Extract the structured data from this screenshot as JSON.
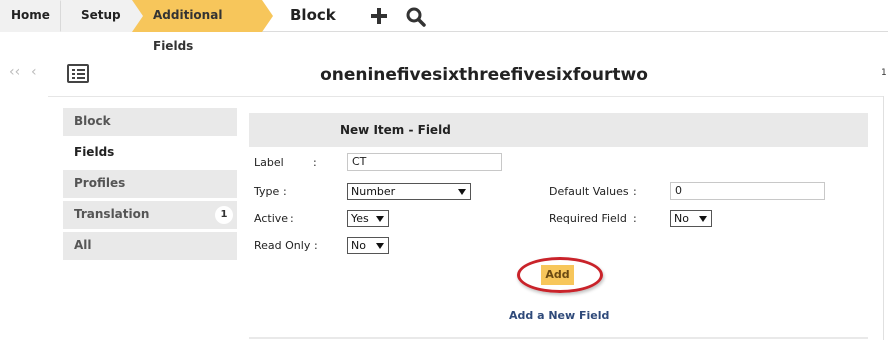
{
  "breadcrumb": {
    "items": [
      "Home",
      "Setup",
      "Additional Fields"
    ],
    "current": "Block"
  },
  "icons": {
    "add": "plus-icon",
    "search": "search-icon",
    "list": "list-icon"
  },
  "record": {
    "title": "oneninefivesixthreefivesixfourtwo",
    "right_indicator": "1"
  },
  "menu": {
    "items": [
      {
        "label": "Block"
      },
      {
        "label": "Fields"
      },
      {
        "label": "Profiles"
      },
      {
        "label": "Translation",
        "badge": "1"
      },
      {
        "label": "All"
      }
    ],
    "selected": "Fields"
  },
  "form": {
    "title": "New Item - Field",
    "label_label": "Label",
    "label_value": "CT",
    "type_label": "Type",
    "type_value": "Number",
    "default_label": "Default Values",
    "default_value": "0",
    "active_label": "Active",
    "active_value": "Yes",
    "required_label": "Required Field",
    "required_value": "No",
    "readonly_label": "Read Only",
    "readonly_value": "No",
    "colon": ":",
    "add_button": "Add",
    "add_new_link": "Add a New Field"
  },
  "colors": {
    "accent": "#f7c65b",
    "highlight": "#c9232a",
    "link": "#2f4a7a"
  }
}
